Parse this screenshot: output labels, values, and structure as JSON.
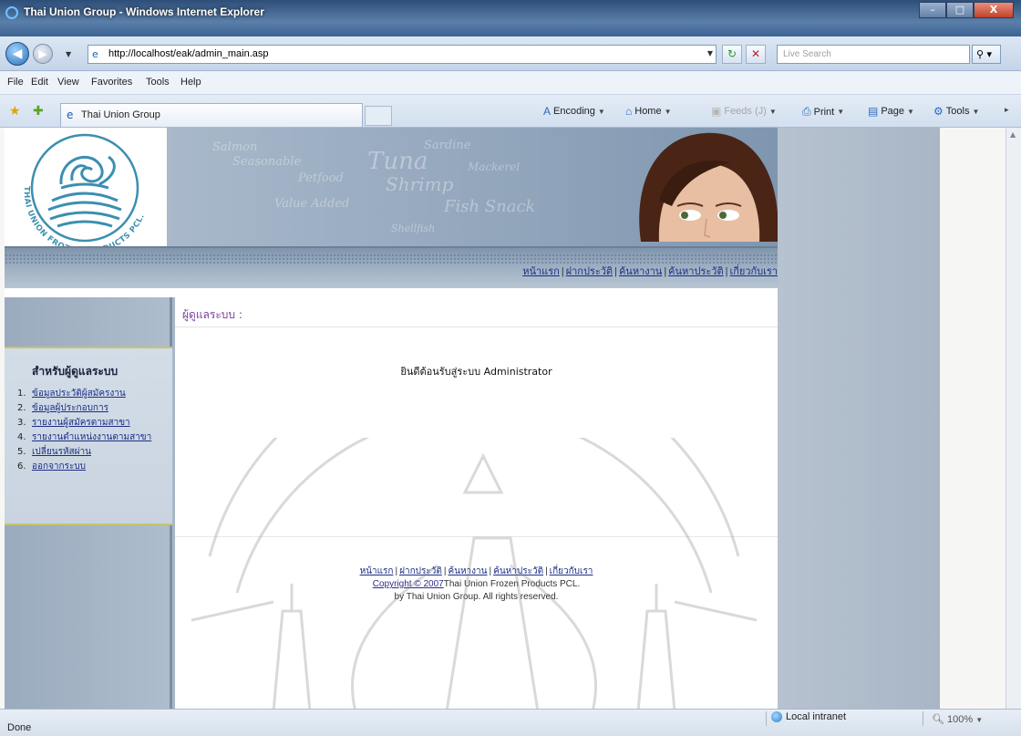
{
  "window": {
    "title": "Thai Union Group - Windows Internet Explorer",
    "buttons": {
      "minimize": "–",
      "maximize": "□",
      "close": "X"
    }
  },
  "navbar": {
    "back": "◀",
    "forward": "▶",
    "url": "http://localhost/eak/admin_main.asp",
    "search_placeholder": "Live Search",
    "refresh_glyph": "↻",
    "stop_glyph": "✕"
  },
  "menu": [
    "File",
    "Edit",
    "View",
    "Favorites",
    "Tools",
    "Help"
  ],
  "tabs": [
    {
      "label": "Thai Union Group"
    }
  ],
  "commandbar": {
    "encoding": "Encoding",
    "home": "Home",
    "feeds": "Feeds (J)",
    "print": "Print",
    "page": "Page",
    "tools": "Tools"
  },
  "site": {
    "logo_text": "THAI UNION FROZEN PRODUCTS PCL.",
    "header_words": [
      "Salmon",
      "Sardine",
      "Tuna",
      "Mackerel",
      "Seasonable",
      "Petfood",
      "Shrimp",
      "Value Added",
      "Fish Snack",
      "Shellfish"
    ],
    "top_links": [
      "หน้าแรก",
      "ฝากประวัติ",
      "ค้นหางาน",
      "ค้นหาประวัติ",
      "เกี่ยวกับเรา"
    ],
    "sidebar": {
      "title": "สำหรับผู้ดูแลระบบ",
      "items": [
        {
          "num": "1.",
          "label": "ข้อมูลประวัติผู้สมัครงาน"
        },
        {
          "num": "2.",
          "label": "ข้อมูลผู้ประกอบการ"
        },
        {
          "num": "3.",
          "label": "รายงานผู้สมัครตามสาขา"
        },
        {
          "num": "4.",
          "label": "รายงานตำแหน่งงานตามสาขา"
        },
        {
          "num": "5.",
          "label": "เปลี่ยนรหัสผ่าน"
        },
        {
          "num": "6.",
          "label": "ออกจากระบบ"
        }
      ]
    },
    "main": {
      "title": "ผู้ดูแลระบบ :",
      "welcome": "ยินดีต้อนรับสู่ระบบ Administrator"
    },
    "footer": {
      "links": [
        "หน้าแรก",
        "ฝากประวัติ",
        "ค้นหางาน",
        "ค้นหาประวัติ",
        "เกี่ยวกับเรา"
      ],
      "copyright_link": "Copyright © 2007",
      "company": "Thai Union Frozen Products PCL.",
      "rights": "by Thai Union Group. All rights reserved."
    }
  },
  "status": {
    "text": "Done",
    "zone": "Local intranet",
    "zoom": "100%"
  },
  "colors": {
    "link": "#1b2e86",
    "main_title": "#7a3fa0",
    "logo": "#3b8fb1"
  }
}
